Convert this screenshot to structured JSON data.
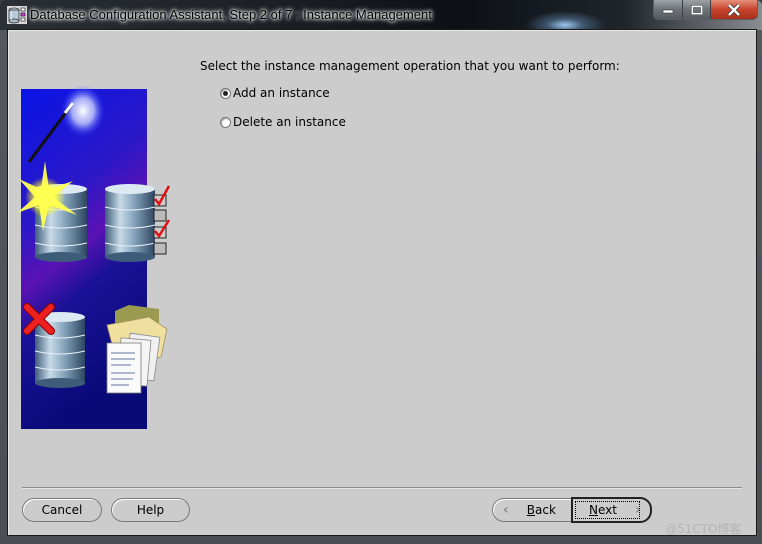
{
  "window": {
    "title": "Database Configuration Assistant, Step 2 of 7 : Instance Management",
    "app_icon": "database-icon",
    "controls": {
      "minimize": "minimize-icon",
      "maximize": "maximize-icon",
      "close": "close-icon"
    }
  },
  "main": {
    "instruction": "Select the instance management operation that you want to perform:",
    "options": [
      {
        "label": "Add an instance",
        "selected": true
      },
      {
        "label": "Delete an instance",
        "selected": false
      }
    ]
  },
  "illustration": {
    "elements": [
      "magic-wand-icon",
      "sparkle-icon",
      "database-icon",
      "checklist-icon",
      "delete-x-icon",
      "folder-icon",
      "documents-icon"
    ],
    "colors": {
      "background_top": "#0a1ae0",
      "background_mid": "#5a10b8",
      "background_bottom": "#0a0a7a"
    }
  },
  "footer": {
    "cancel_label": "Cancel",
    "help_label": "Help",
    "back_label": "Back",
    "back_mnemonic": "B",
    "back_rest": "ack",
    "next_label": "Next",
    "next_mnemonic": "N",
    "next_rest": "ext",
    "back_icon": "chevron-left-icon",
    "next_icon": "chevron-right-icon"
  },
  "watermark": "@51CTO博客"
}
